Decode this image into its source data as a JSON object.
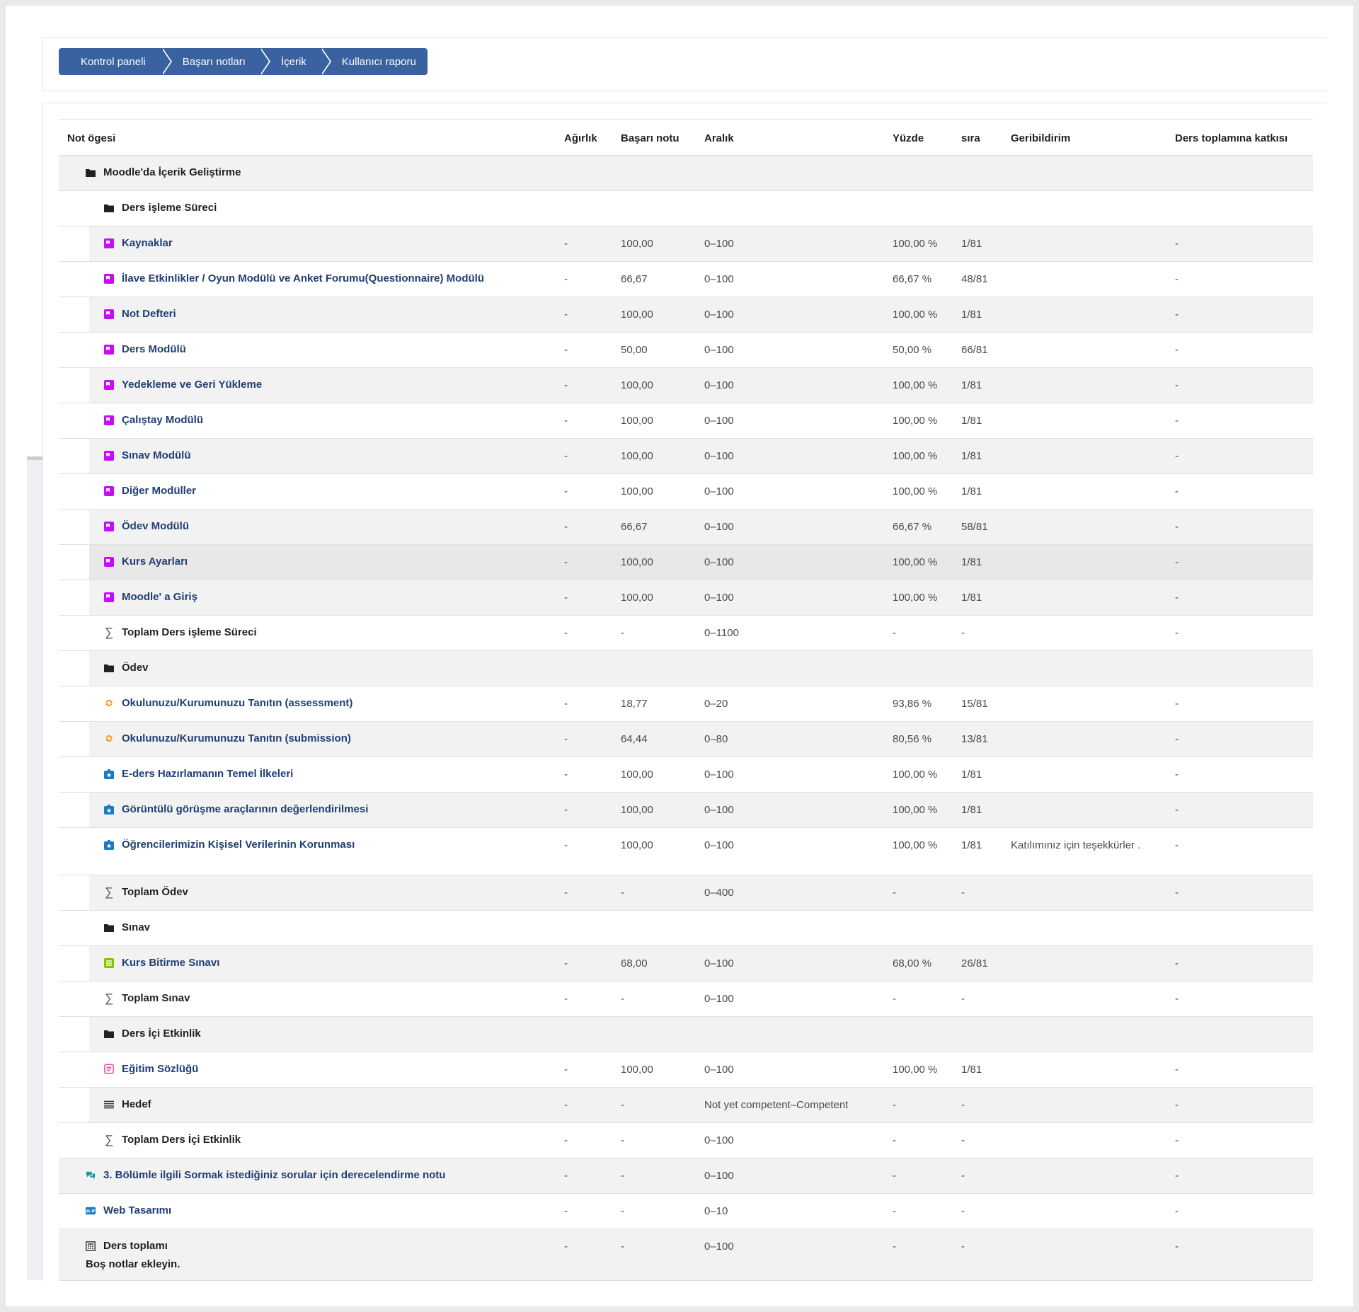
{
  "breadcrumb": [
    "Kontrol paneli",
    "Başarı notları",
    "İçerik",
    "Kullanıcı raporu"
  ],
  "columns": {
    "item": "Not ögesi",
    "weight": "Ağırlık",
    "grade": "Başarı notu",
    "range": "Aralık",
    "percent": "Yüzde",
    "rank": "sıra",
    "feedback": "Geribildirim",
    "contribution": "Ders toplamına katkısı"
  },
  "rows": [
    {
      "type": "category",
      "level": 0,
      "name": "Moodle'da İçerik Geliştirme",
      "icon": "folder-icon"
    },
    {
      "type": "category",
      "level": 1,
      "name": "Ders işleme Süreci",
      "icon": "folder-icon"
    },
    {
      "type": "item",
      "level": 1,
      "icon": "lesson-icon",
      "name": "Kaynaklar",
      "weight": "-",
      "grade": "100,00",
      "range": "0–100",
      "percent": "100,00 %",
      "rank": "1/81",
      "feedback": "",
      "contribution": "-"
    },
    {
      "type": "item",
      "level": 1,
      "icon": "lesson-icon",
      "name": "İlave Etkinlikler / Oyun Modülü ve Anket Forumu(Questionnaire) Modülü",
      "weight": "-",
      "grade": "66,67",
      "range": "0–100",
      "percent": "66,67 %",
      "rank": "48/81",
      "feedback": "",
      "contribution": "-"
    },
    {
      "type": "item",
      "level": 1,
      "icon": "lesson-icon",
      "name": "Not Defteri",
      "weight": "-",
      "grade": "100,00",
      "range": "0–100",
      "percent": "100,00 %",
      "rank": "1/81",
      "feedback": "",
      "contribution": "-"
    },
    {
      "type": "item",
      "level": 1,
      "icon": "lesson-icon",
      "name": "Ders Modülü",
      "weight": "-",
      "grade": "50,00",
      "range": "0–100",
      "percent": "50,00 %",
      "rank": "66/81",
      "feedback": "",
      "contribution": "-"
    },
    {
      "type": "item",
      "level": 1,
      "icon": "lesson-icon",
      "name": "Yedekleme ve Geri Yükleme",
      "weight": "-",
      "grade": "100,00",
      "range": "0–100",
      "percent": "100,00 %",
      "rank": "1/81",
      "feedback": "",
      "contribution": "-"
    },
    {
      "type": "item",
      "level": 1,
      "icon": "lesson-icon",
      "name": "Çalıştay Modülü",
      "weight": "-",
      "grade": "100,00",
      "range": "0–100",
      "percent": "100,00 %",
      "rank": "1/81",
      "feedback": "",
      "contribution": "-"
    },
    {
      "type": "item",
      "level": 1,
      "icon": "lesson-icon",
      "name": "Sınav Modülü",
      "weight": "-",
      "grade": "100,00",
      "range": "0–100",
      "percent": "100,00 %",
      "rank": "1/81",
      "feedback": "",
      "contribution": "-"
    },
    {
      "type": "item",
      "level": 1,
      "icon": "lesson-icon",
      "name": "Diğer Modüller",
      "weight": "-",
      "grade": "100,00",
      "range": "0–100",
      "percent": "100,00 %",
      "rank": "1/81",
      "feedback": "",
      "contribution": "-"
    },
    {
      "type": "item",
      "level": 1,
      "icon": "lesson-icon",
      "name": "Ödev Modülü",
      "weight": "-",
      "grade": "66,67",
      "range": "0–100",
      "percent": "66,67 %",
      "rank": "58/81",
      "feedback": "",
      "contribution": "-"
    },
    {
      "type": "item",
      "level": 1,
      "icon": "lesson-icon",
      "name": "Kurs Ayarları",
      "weight": "-",
      "grade": "100,00",
      "range": "0–100",
      "percent": "100,00 %",
      "rank": "1/81",
      "feedback": "",
      "contribution": "-",
      "hover": true
    },
    {
      "type": "item",
      "level": 1,
      "icon": "lesson-icon",
      "name": "Moodle' a Giriş",
      "weight": "-",
      "grade": "100,00",
      "range": "0–100",
      "percent": "100,00 %",
      "rank": "1/81",
      "feedback": "",
      "contribution": "-"
    },
    {
      "type": "total",
      "level": 1,
      "icon": "sigma-icon",
      "name": "Toplam Ders işleme Süreci",
      "weight": "-",
      "grade": "-",
      "range": "0–1100",
      "percent": "-",
      "rank": "-",
      "feedback": "",
      "contribution": "-"
    },
    {
      "type": "category",
      "level": 1,
      "name": "Ödev",
      "icon": "folder-icon"
    },
    {
      "type": "item",
      "level": 1,
      "icon": "workshop-icon",
      "name": "Okulunuzu/Kurumunuzu Tanıtın (assessment)",
      "weight": "-",
      "grade": "18,77",
      "range": "0–20",
      "percent": "93,86 %",
      "rank": "15/81",
      "feedback": "",
      "contribution": "-"
    },
    {
      "type": "item",
      "level": 1,
      "icon": "workshop-icon",
      "name": "Okulunuzu/Kurumunuzu Tanıtın (submission)",
      "weight": "-",
      "grade": "64,44",
      "range": "0–80",
      "percent": "80,56 %",
      "rank": "13/81",
      "feedback": "",
      "contribution": "-"
    },
    {
      "type": "item",
      "level": 1,
      "icon": "assignment-icon",
      "name": "E-ders Hazırlamanın Temel İlkeleri",
      "weight": "-",
      "grade": "100,00",
      "range": "0–100",
      "percent": "100,00 %",
      "rank": "1/81",
      "feedback": "",
      "contribution": "-"
    },
    {
      "type": "item",
      "level": 1,
      "icon": "assignment-icon",
      "name": "Görüntülü görüşme araçlarının değerlendirilmesi",
      "weight": "-",
      "grade": "100,00",
      "range": "0–100",
      "percent": "100,00 %",
      "rank": "1/81",
      "feedback": "",
      "contribution": "-"
    },
    {
      "type": "item",
      "level": 1,
      "icon": "assignment-icon",
      "name": "Öğrencilerimizin Kişisel Verilerinin Korunması",
      "weight": "-",
      "grade": "100,00",
      "range": "0–100",
      "percent": "100,00 %",
      "rank": "1/81",
      "feedback": "Katılımınız için teşekkürler .",
      "contribution": "-",
      "tall": true
    },
    {
      "type": "total",
      "level": 1,
      "icon": "sigma-icon",
      "name": "Toplam Ödev",
      "weight": "-",
      "grade": "-",
      "range": "0–400",
      "percent": "-",
      "rank": "-",
      "feedback": "",
      "contribution": "-"
    },
    {
      "type": "category",
      "level": 1,
      "name": "Sınav",
      "icon": "folder-icon"
    },
    {
      "type": "item",
      "level": 1,
      "icon": "quiz-icon",
      "name": "Kurs Bitirme Sınavı",
      "weight": "-",
      "grade": "68,00",
      "range": "0–100",
      "percent": "68,00 %",
      "rank": "26/81",
      "feedback": "",
      "contribution": "-"
    },
    {
      "type": "total",
      "level": 1,
      "icon": "sigma-icon",
      "name": "Toplam Sınav",
      "weight": "-",
      "grade": "-",
      "range": "0–100",
      "percent": "-",
      "rank": "-",
      "feedback": "",
      "contribution": "-"
    },
    {
      "type": "category",
      "level": 1,
      "name": "Ders İçi Etkinlik",
      "icon": "folder-icon"
    },
    {
      "type": "item",
      "level": 1,
      "icon": "glossary-icon",
      "name": "Eğitim Sözlüğü",
      "weight": "-",
      "grade": "100,00",
      "range": "0–100",
      "percent": "100,00 %",
      "rank": "1/81",
      "feedback": "",
      "contribution": "-"
    },
    {
      "type": "outcome",
      "level": 1,
      "icon": "outcome-icon",
      "name": "Hedef",
      "weight": "-",
      "grade": "-",
      "range": "Not yet competent–Competent",
      "percent": "-",
      "rank": "-",
      "feedback": "",
      "contribution": "-"
    },
    {
      "type": "total",
      "level": 1,
      "icon": "sigma-icon",
      "name": "Toplam Ders İçi Etkinlik",
      "weight": "-",
      "grade": "-",
      "range": "0–100",
      "percent": "-",
      "rank": "-",
      "feedback": "",
      "contribution": "-"
    },
    {
      "type": "item",
      "level": 0,
      "icon": "forum-icon",
      "name": "3. Bölümle ilgili Sormak istediğiniz sorular için derecelendirme notu",
      "weight": "-",
      "grade": "-",
      "range": "0–100",
      "percent": "-",
      "rank": "-",
      "feedback": "",
      "contribution": "-"
    },
    {
      "type": "item",
      "level": 0,
      "icon": "h5p-icon",
      "name": "Web Tasarımı",
      "weight": "-",
      "grade": "-",
      "range": "0–10",
      "percent": "-",
      "rank": "-",
      "feedback": "",
      "contribution": "-"
    },
    {
      "type": "coursetotal",
      "level": 0,
      "icon": "calculator-icon",
      "name": "Ders toplamı",
      "sub": "Boş notlar ekleyin.",
      "weight": "-",
      "grade": "-",
      "range": "0–100",
      "percent": "-",
      "rank": "-",
      "feedback": "",
      "contribution": "-"
    }
  ],
  "colors": {
    "breadcrumb": "#3a61a0",
    "link": "#203e74",
    "lesson": "#c80aff",
    "workshop": "#f7941d",
    "assignment": "#1a7bc1",
    "quiz": "#82c400",
    "glossary": "#e8479c",
    "forum": "#1a9e9e"
  }
}
